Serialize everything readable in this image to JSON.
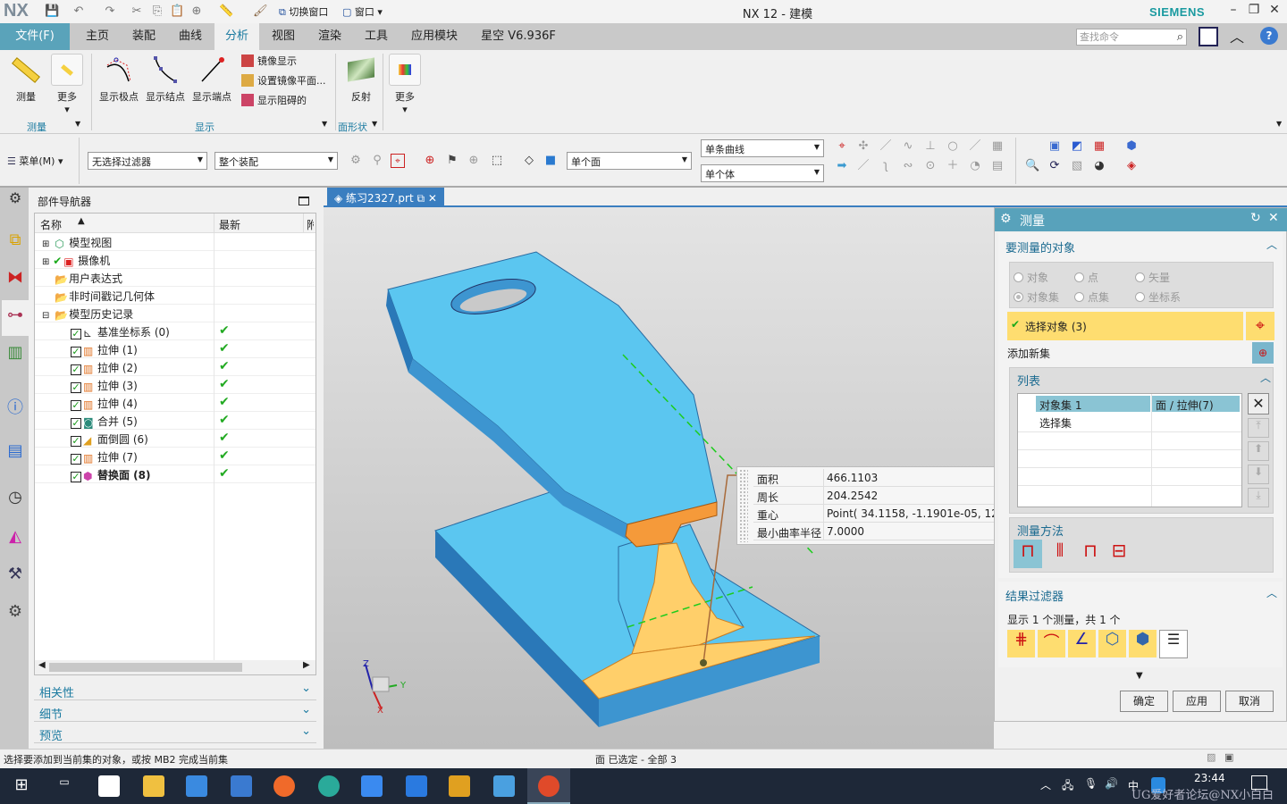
{
  "app": {
    "logo": "NX",
    "title": "NX 12 - 建模",
    "brand": "SIEMENS",
    "quick_access": {
      "switch_window": "切换窗口",
      "window": "窗口"
    }
  },
  "menu_tabs": [
    {
      "label": "文件(F)"
    },
    {
      "label": "主页"
    },
    {
      "label": "装配"
    },
    {
      "label": "曲线"
    },
    {
      "label": "分析",
      "active": true
    },
    {
      "label": "视图"
    },
    {
      "label": "渲染"
    },
    {
      "label": "工具"
    },
    {
      "label": "应用模块"
    },
    {
      "label": "星空 V6.936F"
    }
  ],
  "search": {
    "placeholder": "查找命令"
  },
  "ribbon": {
    "measure": "测量",
    "more1": "更多",
    "group_measure": "测量",
    "show_poles": "显示极点",
    "show_knots": "显示结点",
    "show_ends": "显示端点",
    "mirror_display": "镜像显示",
    "set_mirror_plane": "设置镜像平面...",
    "show_blocking": "显示阻碍的",
    "group_display": "显示",
    "reflection": "反射",
    "group_face_shape": "面形状",
    "more2": "更多"
  },
  "toolbar": {
    "menu": "菜单(M)",
    "filter": "无选择过滤器",
    "scope": "整个装配",
    "face_rule": "单个面",
    "curve_rule": "单条曲线",
    "body_rule": "单个体"
  },
  "navigator": {
    "title": "部件导航器",
    "col_name": "名称",
    "col_latest": "最新",
    "col_extra": "附",
    "items": [
      {
        "label": "模型视图",
        "latest": ""
      },
      {
        "label": "摄像机",
        "latest": ""
      },
      {
        "label": "用户表达式",
        "latest": ""
      },
      {
        "label": "非时间戳记几何体",
        "latest": ""
      },
      {
        "label": "模型历史记录",
        "latest": ""
      },
      {
        "label": "基准坐标系 (0)",
        "latest": "✔"
      },
      {
        "label": "拉伸 (1)",
        "latest": "✔"
      },
      {
        "label": "拉伸 (2)",
        "latest": "✔"
      },
      {
        "label": "拉伸 (3)",
        "latest": "✔"
      },
      {
        "label": "拉伸 (4)",
        "latest": "✔"
      },
      {
        "label": "合并 (5)",
        "latest": "✔"
      },
      {
        "label": "面倒圆 (6)",
        "latest": "✔"
      },
      {
        "label": "拉伸 (7)",
        "latest": "✔"
      },
      {
        "label": "替换面 (8)",
        "latest": "✔"
      }
    ],
    "sections": [
      "相关性",
      "细节",
      "预览"
    ]
  },
  "doc_tab": {
    "label": "练习2327.prt"
  },
  "measure_info": [
    {
      "key": "面积",
      "value": "466.1103"
    },
    {
      "key": "周长",
      "value": "204.2542"
    },
    {
      "key": "重心",
      "value": "Point( 34.1158, -1.1901e-05, 12.1"
    },
    {
      "key": "最小曲率半径",
      "value": "7.0000"
    }
  ],
  "triad": {
    "x": "X",
    "y": "Y",
    "z": "Z"
  },
  "dialog": {
    "title": "测量",
    "section_objects": "要测量的对象",
    "radios": [
      {
        "label": "对象"
      },
      {
        "label": "点"
      },
      {
        "label": "矢量"
      },
      {
        "label": "对象集",
        "selected": true
      },
      {
        "label": "点集"
      },
      {
        "label": "坐标系"
      }
    ],
    "select_objects": "选择对象 (3)",
    "add_new_set": "添加新集",
    "list_title": "列表",
    "list_rows": [
      {
        "name": "对象集 1",
        "value": "面 / 拉伸(7)"
      },
      {
        "name": "选择集",
        "value": ""
      }
    ],
    "method_title": "测量方法",
    "filter_title": "结果过滤器",
    "filter_summary": "显示 1 个测量，共 1 个",
    "ok": "确定",
    "apply": "应用",
    "cancel": "取消"
  },
  "status": {
    "prompt": "选择要添加到当前集的对象，或按 MB2 完成当前集",
    "selection": "面 已选定 - 全部 3"
  },
  "taskbar": {
    "time": "23:44",
    "ime": "中",
    "watermark": "UG爱好者论坛@NX小白白"
  },
  "colors": {
    "accent": "#58a2bb",
    "model_face": "#5bc6f0",
    "selected_face": "#ffcf6a",
    "highlight": "#fedd70"
  }
}
